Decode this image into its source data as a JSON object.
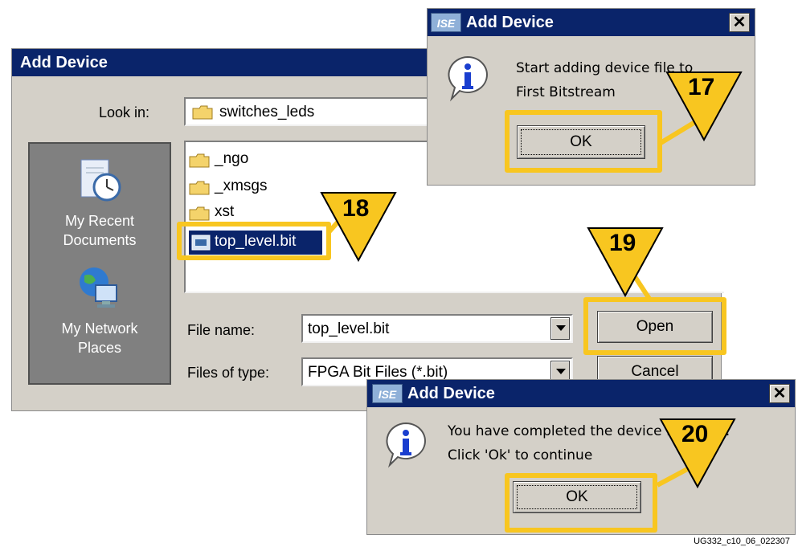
{
  "main_dialog": {
    "title": "Add Device",
    "look_in_label": "Look in:",
    "look_in_value": "switches_leds",
    "places": [
      {
        "label": "My Recent\nDocuments",
        "icon": "recent-documents-icon"
      },
      {
        "label": "My Network\nPlaces",
        "icon": "network-places-icon"
      }
    ],
    "files": [
      {
        "name": "_ngo",
        "icon": "folder-icon"
      },
      {
        "name": "_xmsgs",
        "icon": "folder-icon"
      },
      {
        "name": "xst",
        "icon": "folder-icon"
      },
      {
        "name": "top_level.bit",
        "icon": "bit-file-icon",
        "selected": true
      }
    ],
    "file_name_label": "File name:",
    "file_name_value": "top_level.bit",
    "files_of_type_label": "Files of type:",
    "files_of_type_value": "FPGA Bit Files (*.bit)",
    "open_label": "Open",
    "cancel_label": "Cancel"
  },
  "dialog_17": {
    "title": "Add Device",
    "app_icon": "ISE",
    "message_line1": "Start adding device file to",
    "message_line2": "First Bitstream",
    "ok_label": "OK"
  },
  "dialog_20": {
    "title": "Add Device",
    "app_icon": "ISE",
    "message_line1": "You have completed the device file entry.",
    "message_line2": "Click 'Ok' to continue",
    "ok_label": "OK"
  },
  "callouts": [
    "17",
    "18",
    "19",
    "20"
  ],
  "footer": "UG332_c10_06_022307",
  "colors": {
    "highlight": "#f8c620",
    "titlebar": "#0a246a",
    "dialog": "#d4d0c8",
    "places_bar": "#808080"
  }
}
